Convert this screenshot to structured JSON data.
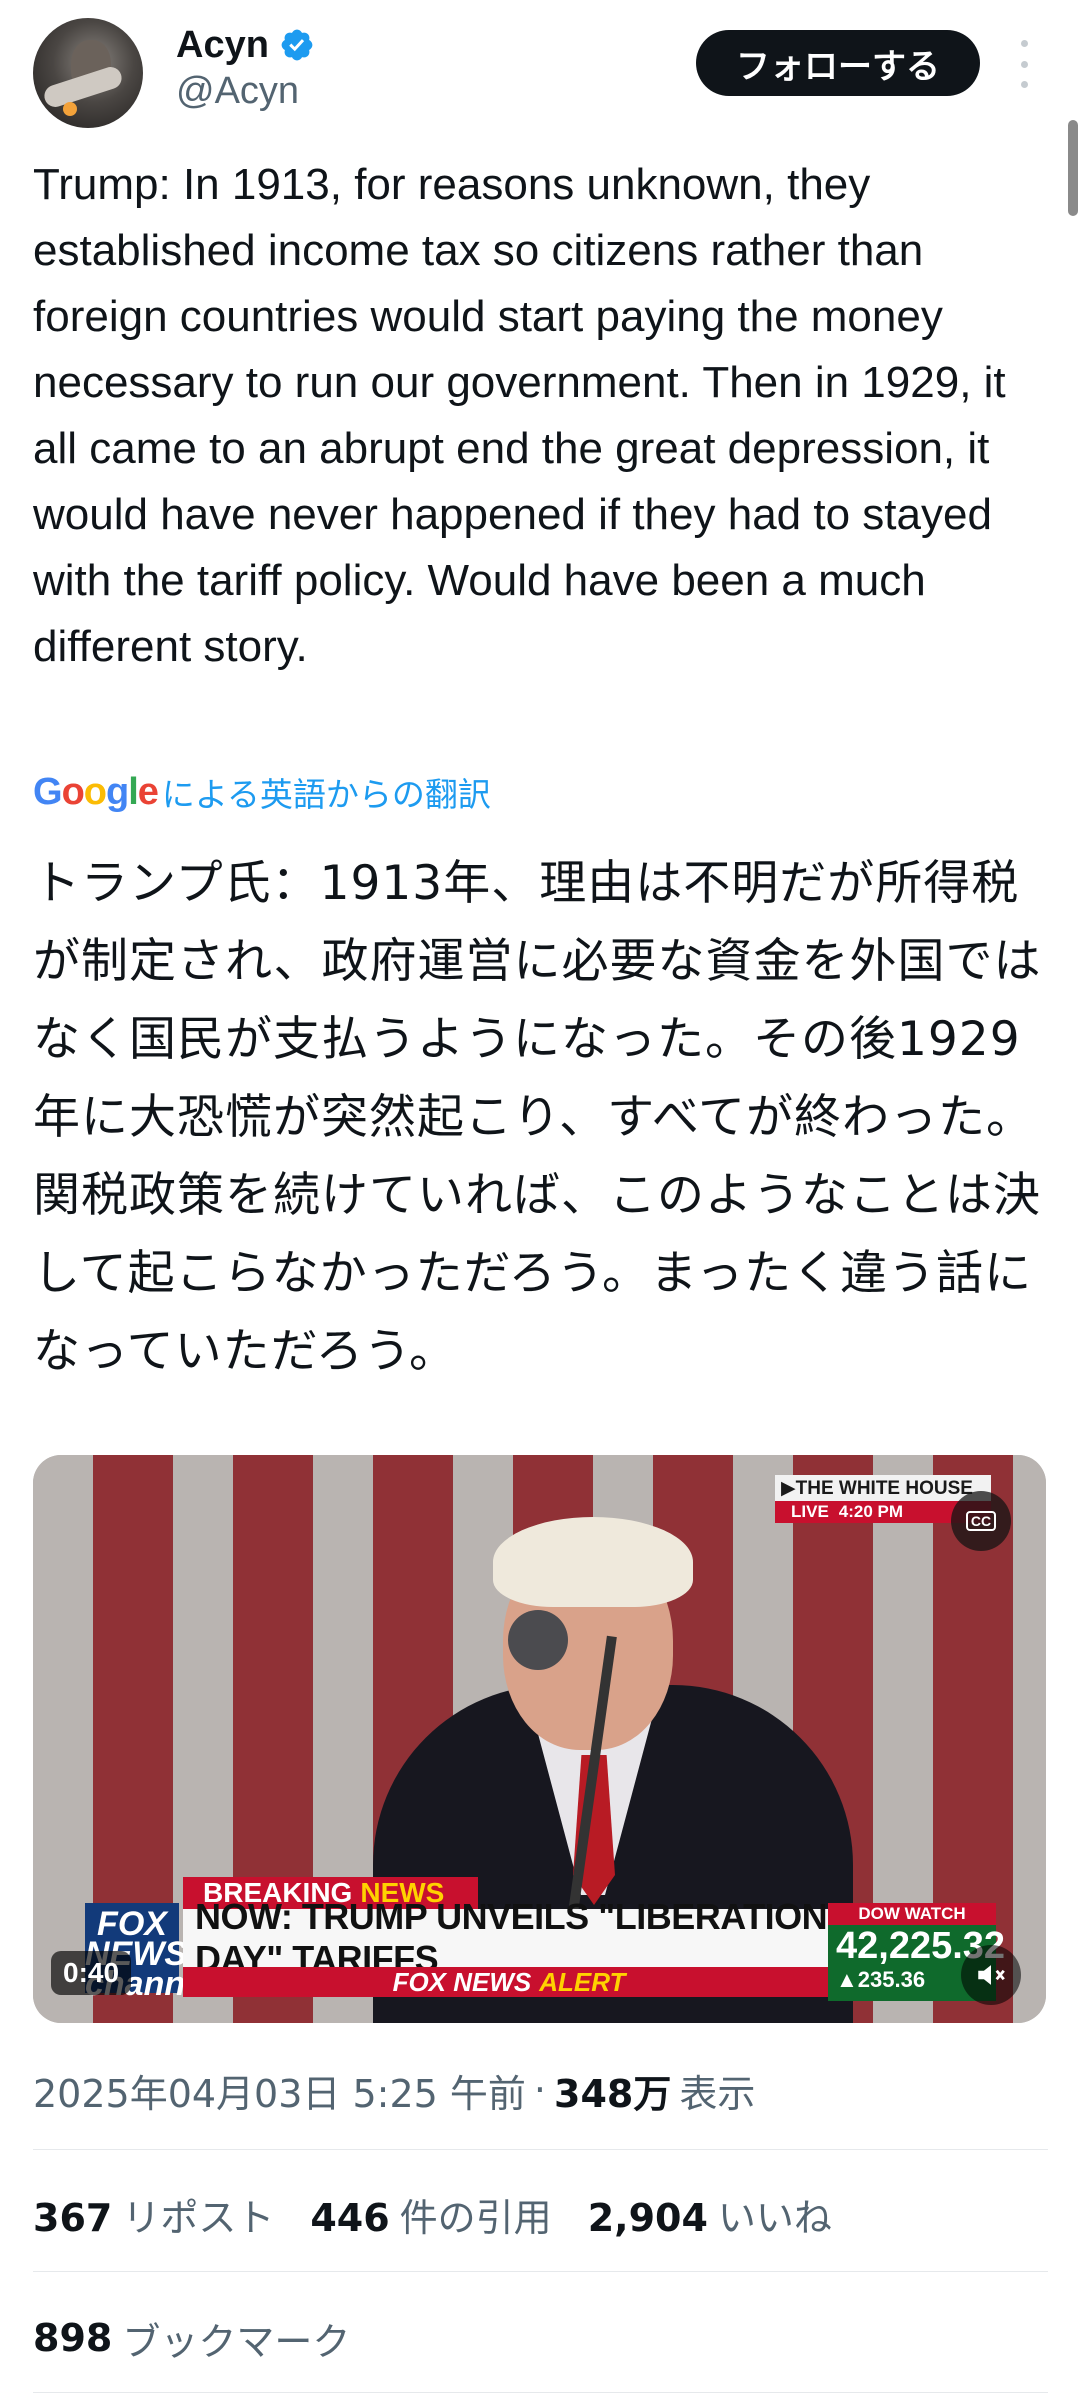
{
  "author": {
    "name": "Acyn",
    "handle": "@Acyn",
    "follow_label": "フォローする"
  },
  "tweet": {
    "text_en": "Trump: In 1913, for reasons unknown, they established income tax so citizens rather than foreign countries would start paying the money necessary to run our government. Then in 1929, it all came to an abrupt end the great depression, it would have never happened if they had to stayed with the tariff policy. Would have been a much different story.",
    "translation_label": "による英語からの翻訳",
    "google_wordmark": [
      "G",
      "o",
      "o",
      "g",
      "l",
      "e"
    ],
    "text_ja": "トランプ氏：1913年、理由は不明だが所得税が制定され、政府運営に必要な資金を外国ではなく国民が支払うようになった。その後1929年に大恐慌が突然起こり、すべてが終わった。関税政策を続けていれば、このようなことは決して起こらなかっただろう。まったく違う話になっていただろう。"
  },
  "video": {
    "duration": "0:40",
    "channel_badge_top": "▶THE WHITE HOUSE",
    "channel_badge_live": "LIVE",
    "channel_badge_time": "4:20 PM",
    "cc_label": "CC",
    "breaking_label": "BREAKING",
    "breaking_news": "NEWS",
    "headline": "NOW: TRUMP UNVEILS \"LIBERATION DAY\" TARIFFS",
    "alert_prefix": "FOX NEWS",
    "alert_word": "ALERT",
    "network_logo": "FOX NEWS channel",
    "dow_label": "DOW WATCH",
    "dow_value": "42,225.32",
    "dow_change": "▲235.36"
  },
  "meta": {
    "timestamp": "2025年04月03日 5:25 午前",
    "separator": "·",
    "views_count": "348万",
    "views_label": "表示"
  },
  "stats": [
    {
      "num": "367",
      "label": "リポスト"
    },
    {
      "num": "446",
      "label": "件の引用"
    },
    {
      "num": "2,904",
      "label": "いいね"
    }
  ],
  "bookmarks": {
    "num": "898",
    "label": "ブックマーク"
  },
  "colors": {
    "accent": "#1d9bf0",
    "text": "#0f1419",
    "muted": "#536471",
    "verified": "#1d9bf0"
  }
}
